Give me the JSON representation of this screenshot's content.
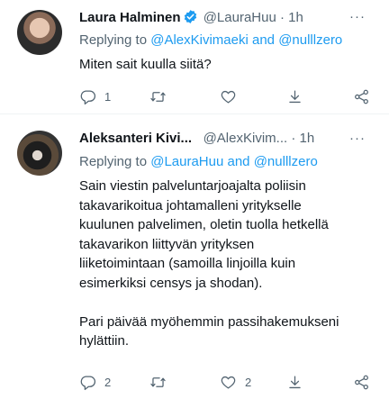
{
  "tweets": [
    {
      "author_name": "Laura Halminen",
      "verified": true,
      "handle": "@LauraHuu",
      "time_sep": "·",
      "time": "1h",
      "more": "···",
      "replying_prefix": "Replying to",
      "replying_mention1": "@AlexKivimaeki",
      "replying_and": "and",
      "replying_mention2": "@nulllzero",
      "text": "Miten sait kuulla siitä?",
      "replies": "1",
      "retweets": "",
      "likes": ""
    },
    {
      "author_name": "Aleksanteri Kivi...",
      "verified": false,
      "handle": "@AlexKivim...",
      "time_sep": "·",
      "time": "1h",
      "more": "···",
      "replying_prefix": "Replying to",
      "replying_mention1": "@LauraHuu",
      "replying_and": "and",
      "replying_mention2": "@nulllzero",
      "text": "Sain viestin palveluntarjoajalta poliisin\ntakavarikoitua johtamalleni yritykselle\nkuulunen palvelimen, oletin tuolla hetkellä\ntakavarikon liittyvän yrityksen\nliiketoimintaan (samoilla linjoilla kuin\nesimerkiksi censys ja shodan).\n\nPari päivää myöhemmin passihakemukseni\nhylättiin.",
      "replies": "2",
      "retweets": "",
      "likes": "2"
    }
  ],
  "colors": {
    "accent": "#1d9bf0",
    "muted": "#536471",
    "text": "#0f1419",
    "divider": "#eff3f4"
  },
  "icons": [
    "verified-badge-icon",
    "more-icon",
    "reply-icon",
    "retweet-icon",
    "like-icon",
    "bookmark-icon",
    "share-icon"
  ]
}
